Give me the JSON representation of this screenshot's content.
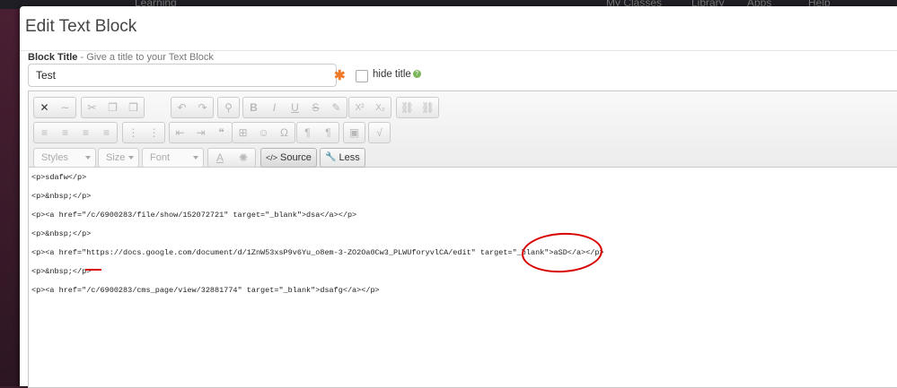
{
  "background": {
    "nav_items": [
      "Learning",
      "My Classes",
      "Library",
      "Apps",
      "Help"
    ]
  },
  "modal": {
    "title": "Edit Text Block"
  },
  "block_title": {
    "label": "Block Title",
    "hint": " - Give a title to your Text Block",
    "value": "Test",
    "required_mark": "✱",
    "hide_title_label": "hide title",
    "help_glyph": "?"
  },
  "toolbar": {
    "row1_icons": [
      "maximize-icon",
      "spellcheck-icon",
      "cut-icon",
      "copy-icon",
      "paste-icon",
      "undo-icon",
      "redo-icon",
      "find-icon",
      "bold-icon",
      "italic-icon",
      "underline-icon",
      "strike-icon",
      "remove-format-icon",
      "superscript-icon",
      "subscript-icon",
      "link-icon",
      "unlink-icon"
    ],
    "row1_glyphs": [
      "✕",
      "∼",
      "✂",
      "❐",
      "❒",
      "↶",
      "↷",
      "⚲",
      "B",
      "I",
      "U",
      "S",
      "✎",
      "X²",
      "X₂",
      "⛓",
      "⛓"
    ],
    "row2_glyphs": [
      "≡",
      "≡",
      "≡",
      "≡",
      "⋮",
      "⋮",
      "⇤",
      "⇥",
      "❝",
      "⊞",
      "☺",
      "Ω",
      "¶",
      "¶",
      "▣",
      "√"
    ],
    "styles_label": "Styles",
    "size_label": "Size",
    "font_label": "Font",
    "text_color_glyph": "A",
    "bg_color_glyph": "✺",
    "source_label": "Source",
    "source_glyph": "</>",
    "less_label": "Less",
    "less_glyph": "🔧"
  },
  "source": {
    "lines": [
      "<p>sdafw</p>",
      "<p>&nbsp;</p>",
      "<p><a href=\"/c/6900283/file/show/152072721\" target=\"_blank\">dsa</a></p>",
      "<p>&nbsp;</p>",
      "<p><a href=\"https://docs.google.com/document/d/1ZnW53xsP9v6Yu_o8em-3-ZO2Oa0Cw3_PLWUforyvlCA/edit\" target=\"_blank\">aSD</a></p>",
      "<p>&nbsp;</p>",
      "<p><a href=\"/c/6900283/cms_page/view/32881774\" target=\"_blank\">dsafg</a></p>"
    ]
  },
  "colors": {
    "annotation": "#d80000",
    "required": "#f07a2a"
  }
}
